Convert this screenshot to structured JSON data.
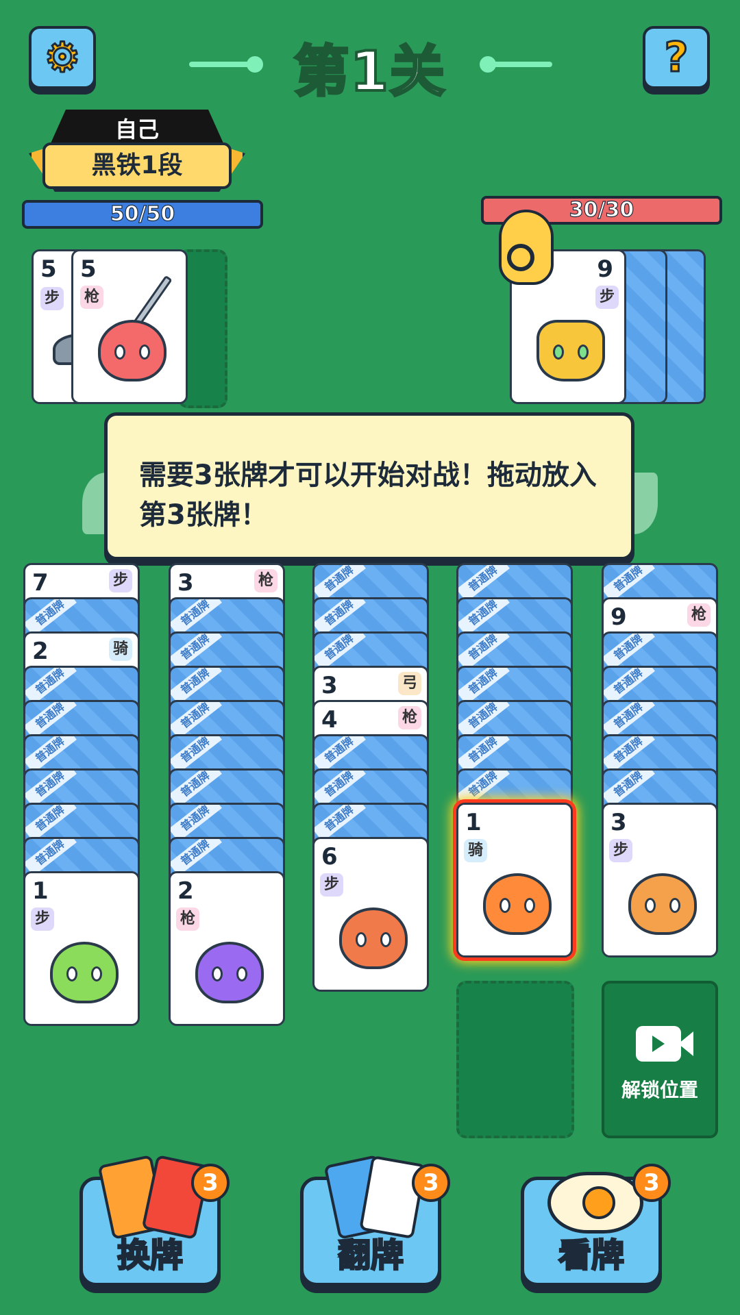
{
  "header": {
    "settings_icon": "gear-icon",
    "help_icon": "question-icon",
    "level_title": "第1关"
  },
  "player": {
    "name": "自己",
    "rank": "黑铁1段",
    "hp_text": "50/50",
    "hp_fraction": 1.0,
    "hp_color": "#3d7fe0"
  },
  "enemy": {
    "hp_text": "30/30",
    "hp_fraction": 1.0,
    "hp_color": "#ec6a6a"
  },
  "player_hand": [
    {
      "num": "5",
      "type": "步"
    },
    {
      "num": "5",
      "type": "枪"
    }
  ],
  "enemy_hand": [
    {
      "num": "9",
      "type": "步"
    }
  ],
  "dialog": {
    "message": "需要3张牌才可以开始对战！拖动放入第3张牌！"
  },
  "card_back_label": "普通牌",
  "columns": [
    {
      "visible_peeks": [
        {
          "num": "7",
          "type": "步"
        },
        {
          "num": "2",
          "type": "骑"
        }
      ],
      "top": {
        "num": "1",
        "type": "步"
      }
    },
    {
      "visible_peeks": [
        {
          "num": "3",
          "type": "枪"
        }
      ],
      "top": {
        "num": "2",
        "type": "枪"
      }
    },
    {
      "visible_peeks": [
        {
          "num": "3",
          "type": "弓"
        },
        {
          "num": "4",
          "type": "枪"
        }
      ],
      "top": {
        "num": "6",
        "type": "步"
      }
    },
    {
      "visible_peeks": [],
      "top": {
        "num": "1",
        "type": "骑"
      }
    },
    {
      "visible_peeks": [
        {
          "num": "9",
          "type": "枪"
        }
      ],
      "top": {
        "num": "3",
        "type": "步"
      }
    }
  ],
  "unlock_slot": {
    "icon": "video-camera-icon",
    "label": "解锁位置"
  },
  "tools": [
    {
      "label": "换牌",
      "count": "3",
      "icon": "swap-cards-icon"
    },
    {
      "label": "翻牌",
      "count": "3",
      "icon": "flip-card-icon"
    },
    {
      "label": "看牌",
      "count": "3",
      "icon": "eye-icon"
    }
  ]
}
